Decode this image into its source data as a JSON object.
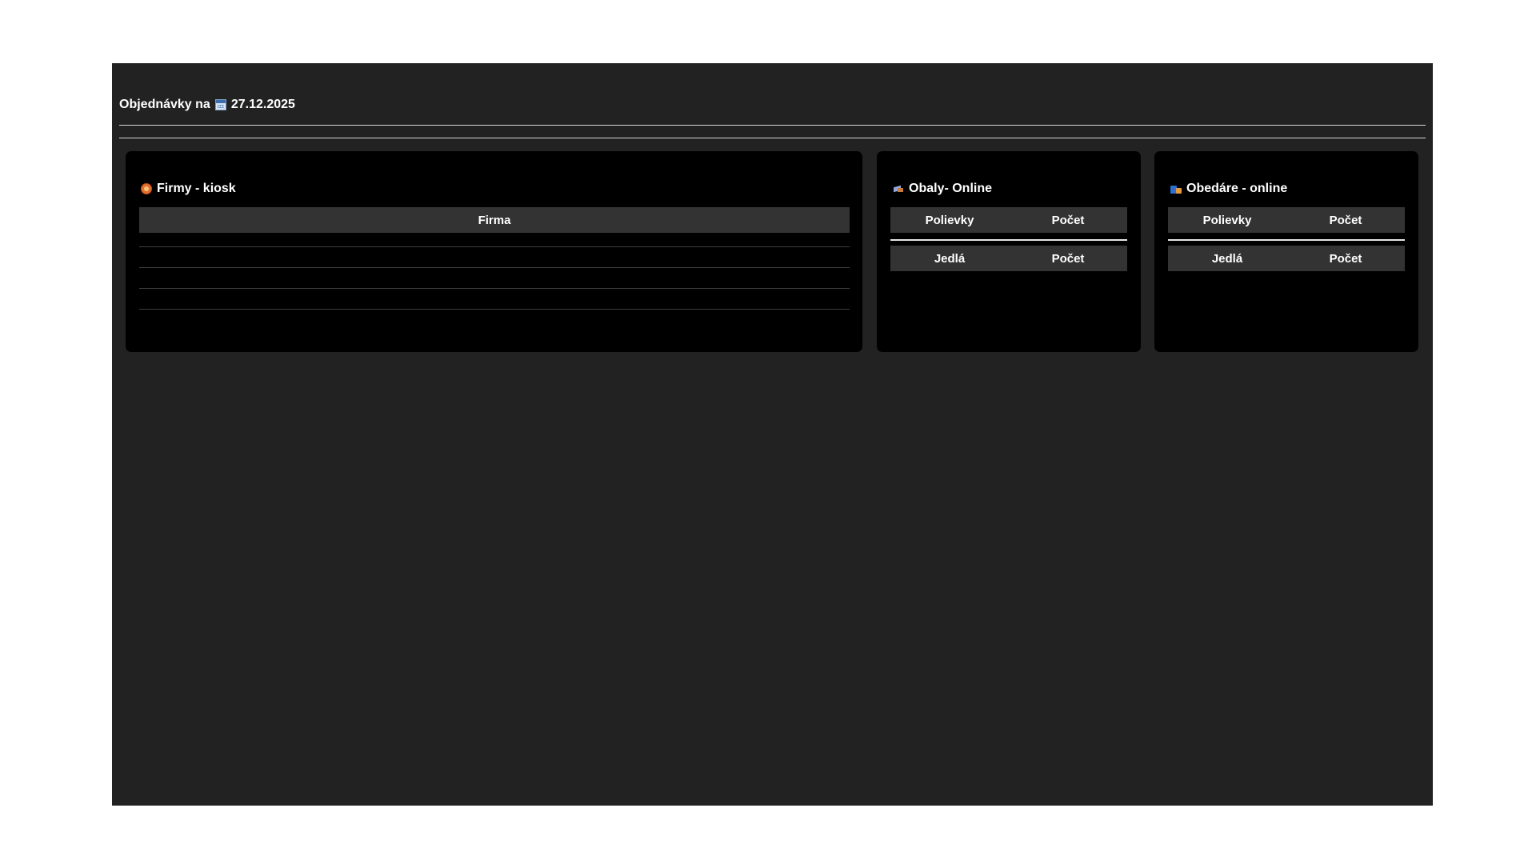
{
  "header": {
    "title": "Objednávky na",
    "date": "27.12.2025",
    "calendar_icon": "calendar-icon"
  },
  "panels": {
    "kiosk": {
      "title": "Firmy - kiosk",
      "icon": "kiosk-icon",
      "columns": [
        "Firma"
      ],
      "rows": []
    },
    "obaly": {
      "title": "Obaly- Online",
      "icon": "package-icon",
      "soups_header": [
        "Polievky",
        "Počet"
      ],
      "meals_header": [
        "Jedlá",
        "Počet"
      ]
    },
    "obedare": {
      "title": "Obedáre - online",
      "icon": "shopping-bags-icon",
      "soups_header": [
        "Polievky",
        "Počet"
      ],
      "meals_header": [
        "Jedlá",
        "Počet"
      ]
    }
  }
}
